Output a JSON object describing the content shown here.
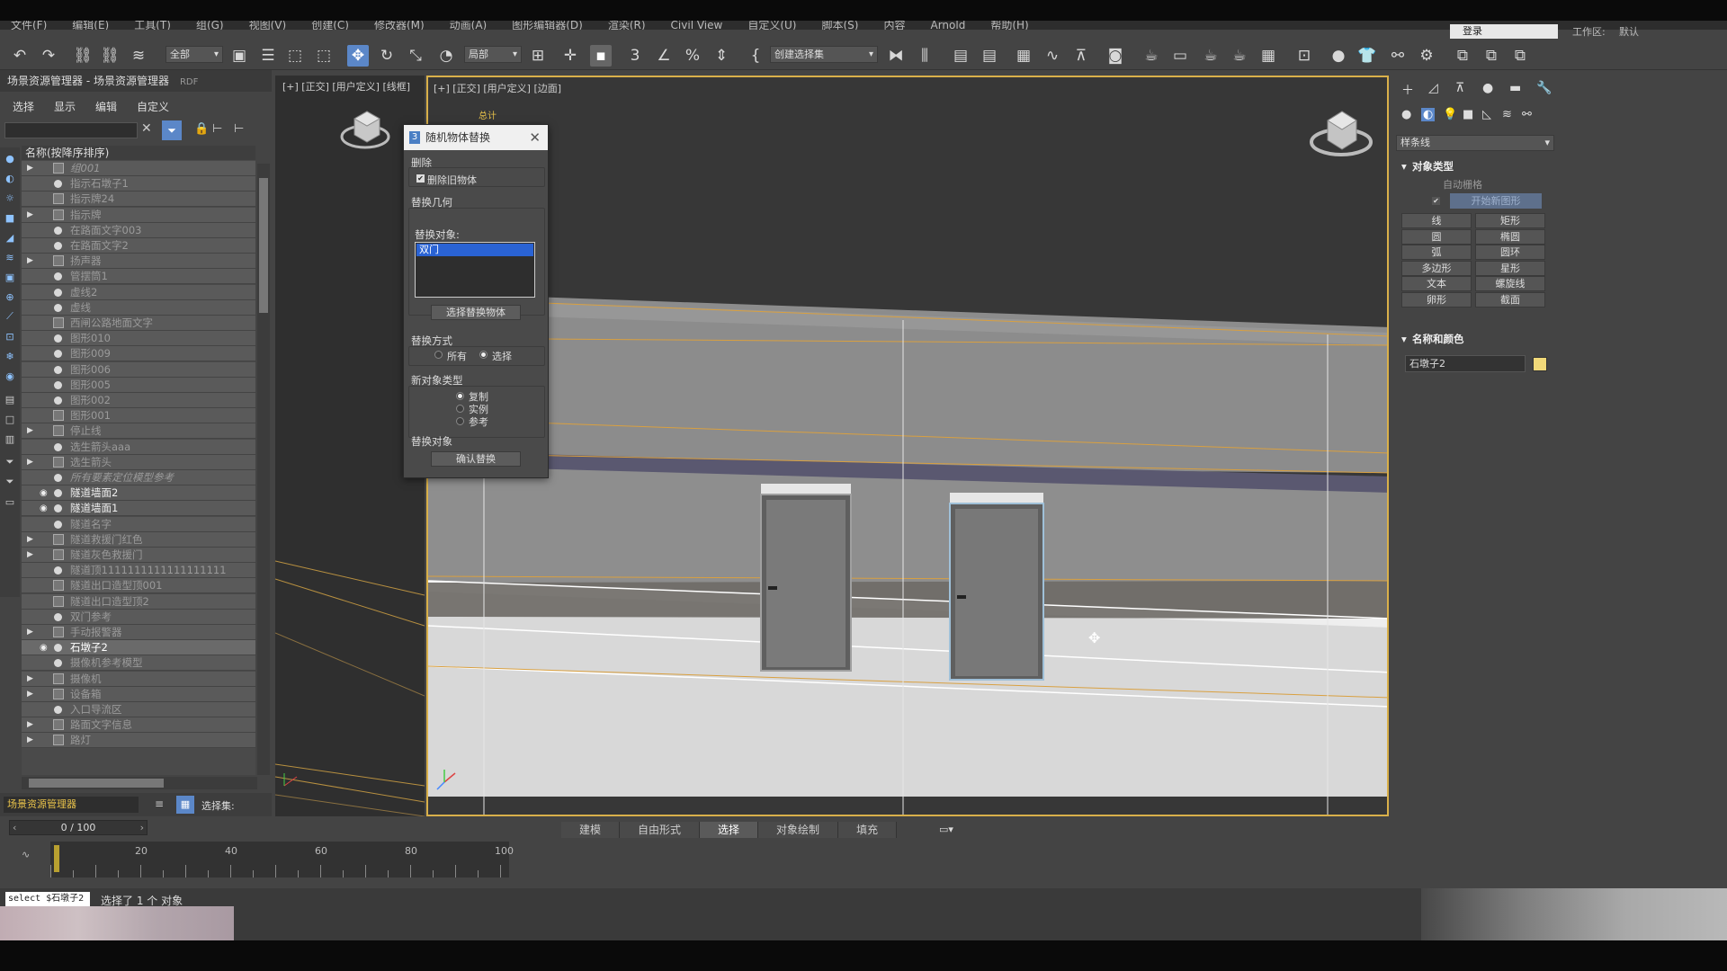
{
  "menubar": [
    "文件(F)",
    "编辑(E)",
    "工具(T)",
    "组(G)",
    "视图(V)",
    "创建(C)",
    "修改器(M)",
    "动画(A)",
    "图形编辑器(D)",
    "渲染(R)",
    "Civil View",
    "自定义(U)",
    "脚本(S)",
    "内容",
    "Arnold",
    "帮助(H)"
  ],
  "workspace": {
    "box_value": "登录",
    "label": "工作区:",
    "value": "默认"
  },
  "toolbar": {
    "filter_select": "全部",
    "coord_select": "局部",
    "named_selection": "创建选择集"
  },
  "explorer": {
    "title": "场景资源管理器 - 场景资源管理器",
    "badge": "RDF",
    "menu": [
      "选择",
      "显示",
      "编辑",
      "自定义"
    ],
    "header": "名称(按降序排序)",
    "items": [
      {
        "label": "组001",
        "arrow": true,
        "eye": false,
        "kind": "grp",
        "ital": true
      },
      {
        "label": "指示石墩子1",
        "arrow": false,
        "eye": false,
        "kind": "dot"
      },
      {
        "label": "指示牌24",
        "arrow": false,
        "eye": false,
        "kind": "grp"
      },
      {
        "label": "指示牌",
        "arrow": true,
        "eye": false,
        "kind": "grp"
      },
      {
        "label": "在路面文字003",
        "arrow": false,
        "eye": false,
        "kind": "dot"
      },
      {
        "label": "在路面文字2",
        "arrow": false,
        "eye": false,
        "kind": "dot"
      },
      {
        "label": "扬声器",
        "arrow": true,
        "eye": false,
        "kind": "grp"
      },
      {
        "label": "管摆筒1",
        "arrow": false,
        "eye": false,
        "kind": "dot"
      },
      {
        "label": "虚线2",
        "arrow": false,
        "eye": false,
        "kind": "dot"
      },
      {
        "label": "虚线",
        "arrow": false,
        "eye": false,
        "kind": "dot"
      },
      {
        "label": "西闸公路地面文字",
        "arrow": false,
        "eye": false,
        "kind": "grp"
      },
      {
        "label": "图形010",
        "arrow": false,
        "eye": false,
        "kind": "dot"
      },
      {
        "label": "图形009",
        "arrow": false,
        "eye": false,
        "kind": "dot"
      },
      {
        "label": "图形006",
        "arrow": false,
        "eye": false,
        "kind": "dot"
      },
      {
        "label": "图形005",
        "arrow": false,
        "eye": false,
        "kind": "dot"
      },
      {
        "label": "图形002",
        "arrow": false,
        "eye": false,
        "kind": "dot"
      },
      {
        "label": "图形001",
        "arrow": false,
        "eye": false,
        "kind": "grp"
      },
      {
        "label": "停止线",
        "arrow": true,
        "eye": false,
        "kind": "grp"
      },
      {
        "label": "选生箭头aaa",
        "arrow": false,
        "eye": false,
        "kind": "dot"
      },
      {
        "label": "选生箭头",
        "arrow": true,
        "eye": false,
        "kind": "grp"
      },
      {
        "label": "所有要素定位模型参考",
        "arrow": false,
        "eye": false,
        "kind": "dot",
        "ital": true
      },
      {
        "label": "隧道墙面2",
        "arrow": false,
        "eye": true,
        "kind": "dot",
        "vis": true
      },
      {
        "label": "隧道墙面1",
        "arrow": false,
        "eye": true,
        "kind": "dot",
        "vis": true
      },
      {
        "label": "隧道名字",
        "arrow": false,
        "eye": false,
        "kind": "dot"
      },
      {
        "label": "隧道救援门红色",
        "arrow": true,
        "eye": false,
        "kind": "grp"
      },
      {
        "label": "隧道灰色救援门",
        "arrow": true,
        "eye": false,
        "kind": "grp"
      },
      {
        "label": "隧道顶1111111111111111111",
        "arrow": false,
        "eye": false,
        "kind": "dot"
      },
      {
        "label": "隧道出口造型顶001",
        "arrow": false,
        "eye": false,
        "kind": "grp"
      },
      {
        "label": "隧道出口造型顶2",
        "arrow": false,
        "eye": false,
        "kind": "grp"
      },
      {
        "label": "双门参考",
        "arrow": false,
        "eye": false,
        "kind": "dot"
      },
      {
        "label": "手动报警器",
        "arrow": true,
        "eye": false,
        "kind": "grp"
      },
      {
        "label": "石墩子2",
        "arrow": false,
        "eye": true,
        "kind": "dot",
        "vis": true,
        "sel": true
      },
      {
        "label": "摄像机参考模型",
        "arrow": false,
        "eye": false,
        "kind": "dot"
      },
      {
        "label": "摄像机",
        "arrow": true,
        "eye": false,
        "kind": "grp"
      },
      {
        "label": "设备箱",
        "arrow": true,
        "eye": false,
        "kind": "grp"
      },
      {
        "label": "入口导流区",
        "arrow": false,
        "eye": false,
        "kind": "dot"
      },
      {
        "label": "路面文字信息",
        "arrow": true,
        "eye": false,
        "kind": "grp"
      },
      {
        "label": "路灯",
        "arrow": true,
        "eye": false,
        "kind": "grp"
      }
    ],
    "bottom_select": "场景资源管理器",
    "selection_set_label": "选择集:"
  },
  "viewports": {
    "left_label": "[+] [正交] [用户定义] [线框]",
    "main_label": "[+] [正交] [用户定义] [边面]",
    "main_overlay_text": "总计"
  },
  "dialog": {
    "title": "随机物体替换",
    "sec_delete": "删除",
    "cb_delete_old": "删除旧物体",
    "sec_geometry": "替换几何",
    "replace_target_label": "替换对象:",
    "list_item": "双门",
    "btn_select": "选择替换物体",
    "sec_mode": "替换方式",
    "mode_all": "所有",
    "mode_selected": "选择",
    "sec_newtype": "新对象类型",
    "type_copy": "复制",
    "type_instance": "实例",
    "type_reference": "参考",
    "sec_replace": "替换对象",
    "btn_confirm": "确认替换"
  },
  "command_panel": {
    "dropdown": "样条线",
    "rollout_object_type": "对象类型",
    "auto_grid": "自动栅格",
    "start_new_shape": "开始新图形",
    "buttons": [
      "线",
      "矩形",
      "圆",
      "椭圆",
      "弧",
      "圆环",
      "多边形",
      "星形",
      "文本",
      "螺旋线",
      "卵形",
      "截面"
    ],
    "rollout_name_color": "名称和颜色",
    "object_name": "石墩子2",
    "object_color": "#f1d979"
  },
  "timeline": {
    "frame": "0 / 100",
    "ticks": [
      "0",
      "20",
      "40",
      "60",
      "80",
      "100"
    ]
  },
  "ribbon_tabs": [
    "建模",
    "自由形式",
    "选择",
    "对象绘制",
    "填充"
  ],
  "ribbon_active": "选择",
  "status": {
    "command": "select $石墩子2",
    "message": "选择了 1 个 对象"
  }
}
